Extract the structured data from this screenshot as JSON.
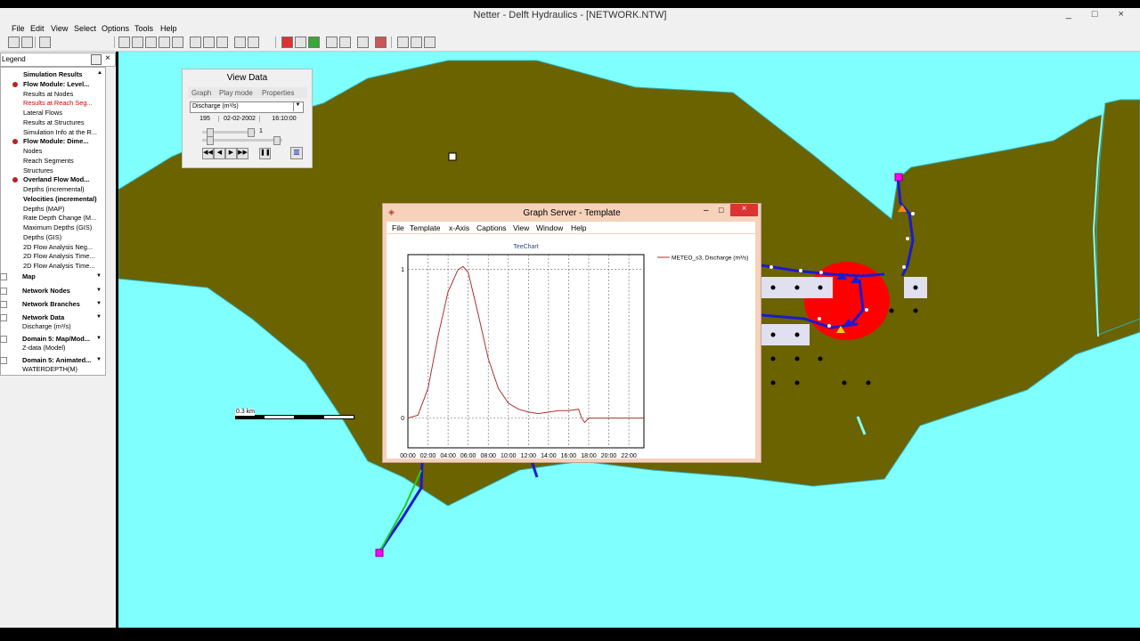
{
  "window": {
    "title": "Netter - Delft Hydraulics - [NETWORK.NTW]",
    "controls": "_ □ ×"
  },
  "menu": [
    "File",
    "Edit",
    "View",
    "Select",
    "Options",
    "Tools",
    "Help"
  ],
  "legend": {
    "title": "Legend",
    "items": [
      {
        "label": "Simulation Results",
        "style": "b",
        "indent": 0
      },
      {
        "label": "Flow Module: Level...",
        "style": "b",
        "indent": 1,
        "dot": true
      },
      {
        "label": "Results at Nodes",
        "style": "",
        "indent": 1
      },
      {
        "label": "Results at Reach Seg...",
        "style": "red",
        "indent": 1
      },
      {
        "label": "Lateral Flows",
        "style": "",
        "indent": 1
      },
      {
        "label": "Results at Structures",
        "style": "",
        "indent": 1
      },
      {
        "label": "Simulation Info at the R...",
        "style": "",
        "indent": 1
      },
      {
        "label": "Flow Module: Dime...",
        "style": "b",
        "indent": 1,
        "dot": true
      },
      {
        "label": "Nodes",
        "style": "",
        "indent": 1
      },
      {
        "label": "Reach Segments",
        "style": "",
        "indent": 1
      },
      {
        "label": "Structures",
        "style": "",
        "indent": 1
      },
      {
        "label": "Overland Flow Mod...",
        "style": "b",
        "indent": 1,
        "dot": true
      },
      {
        "label": "Depths (incremental)",
        "style": "",
        "indent": 1
      },
      {
        "label": "Velocities (incremental)",
        "style": "b",
        "indent": 1
      },
      {
        "label": "Depths (MAP)",
        "style": "",
        "indent": 1
      },
      {
        "label": "Rate Depth Change (M...",
        "style": "",
        "indent": 1
      },
      {
        "label": "Maximum Depths (GIS)",
        "style": "",
        "indent": 1
      },
      {
        "label": "Depths (GIS)",
        "style": "",
        "indent": 1
      },
      {
        "label": "2D Flow Analysis Neg...",
        "style": "",
        "indent": 1
      },
      {
        "label": "2D Flow Analysis Time...",
        "style": "",
        "indent": 1
      },
      {
        "label": "2D Flow Analysis Time...",
        "style": "",
        "indent": 1
      }
    ],
    "sections": [
      {
        "label": "Map",
        "sub": ""
      },
      {
        "label": "Network Nodes",
        "sub": ""
      },
      {
        "label": "Network Branches",
        "sub": ""
      },
      {
        "label": "Network Data",
        "sub": "Discharge (m³/s)"
      },
      {
        "label": "Domain 5: Map/Mod...",
        "sub": "Z-data (Model)"
      },
      {
        "label": "Domain 5: Animated...",
        "sub": "WATERDEPTH(M)"
      }
    ]
  },
  "view_data": {
    "title": "View Data",
    "tabs": [
      "Graph",
      "Play mode",
      "Properties"
    ],
    "parameter": "Discharge (m³/s)",
    "step": "195",
    "date": "02-02-2002",
    "time": "16:10:00",
    "speed": "1"
  },
  "scale_label": "0.3 km",
  "graph_server": {
    "title": "Graph Server  - Template",
    "menu": [
      "File",
      "Template",
      "x-Axis",
      "Captions",
      "View",
      "Window",
      "Help"
    ],
    "chart_title": "TeeChart"
  },
  "chart_data": {
    "type": "line",
    "title": "TeeChart",
    "xlabel": "",
    "ylabel": "",
    "x_ticks": [
      "00:00",
      "02:00",
      "04:00",
      "06:00",
      "08:00",
      "10:00",
      "12:00",
      "14:00",
      "16:00",
      "18:00",
      "20:00",
      "22:00"
    ],
    "y_ticks": [
      "0",
      "1"
    ],
    "ylim": [
      -0.2,
      1.1
    ],
    "xlim": [
      0,
      23.5
    ],
    "grid": true,
    "legend_position": "right",
    "series": [
      {
        "name": "METEO_s3, Discharge (m³/s)",
        "color": "#b03030",
        "x": [
          0,
          1,
          2,
          3,
          4,
          5,
          5.5,
          6,
          7,
          8,
          9,
          10,
          11,
          12,
          13,
          14,
          15,
          16,
          17,
          17.3,
          17.6,
          18,
          19,
          20,
          21,
          22,
          23.5
        ],
        "y": [
          0,
          0.02,
          0.2,
          0.55,
          0.85,
          1.0,
          1.02,
          0.98,
          0.7,
          0.4,
          0.2,
          0.1,
          0.06,
          0.04,
          0.03,
          0.04,
          0.05,
          0.05,
          0.06,
          0.0,
          -0.03,
          0.0,
          0.0,
          0.0,
          0.0,
          0.0,
          0.0
        ]
      }
    ]
  }
}
